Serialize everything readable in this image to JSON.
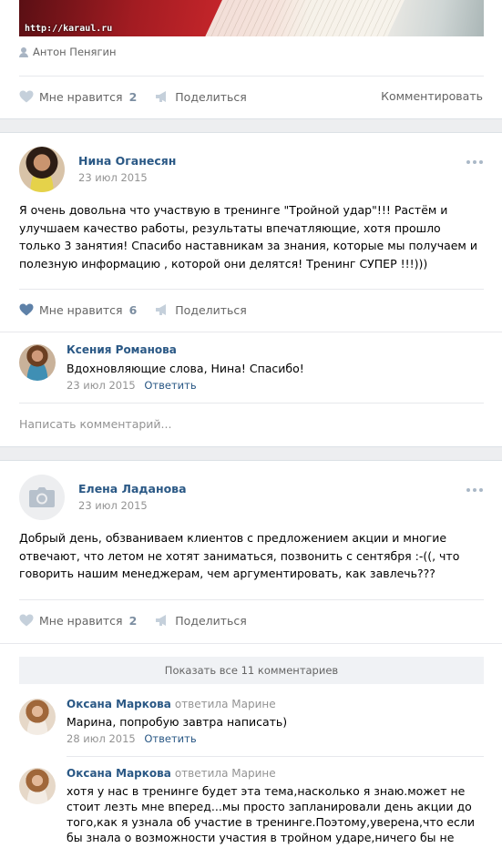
{
  "post1": {
    "watermark": "http://karaul.ru",
    "author": "Антон Пенягин",
    "actions": {
      "like_label": "Мне нравится",
      "like_count": "2",
      "share_label": "Поделиться",
      "comment_label": "Комментировать"
    }
  },
  "post2": {
    "author": "Нина Оганесян",
    "date": "23 июл 2015",
    "text": "Я очень довольна что участвую в тренинге \"Тройной удар\"!!! Растём и улучшаем качество работы, результаты впечатляющие, хотя прошло только 3 занятия! Спасибо наставникам за знания, которые мы получаем и полезную информацию , которой они делятся! Тренинг СУПЕР !!!)))",
    "actions": {
      "like_label": "Мне нравится",
      "like_count": "6",
      "share_label": "Поделиться"
    },
    "comment": {
      "author": "Ксения Романова",
      "text": "Вдохновляющие слова, Нина! Спасибо!",
      "date": "23 июл 2015",
      "reply": "Ответить"
    },
    "write_placeholder": "Написать комментарий..."
  },
  "post3": {
    "author": "Елена Ладанова",
    "date": "23 июл 2015",
    "text": "Добрый день, обзваниваем клиентов с предложением акции и многие отвечают, что летом не хотят заниматься, позвонить с сентября :-((, что говорить нашим менеджерам, чем аргументировать, как завлечь???",
    "actions": {
      "like_label": "Мне нравится",
      "like_count": "2",
      "share_label": "Поделиться"
    },
    "show_all": "Показать все 11 комментариев",
    "comments": [
      {
        "author": "Оксана Маркова",
        "replied": "ответила Марине",
        "text": "Марина, попробую завтра написать)",
        "date": "28 июл 2015",
        "reply": "Ответить"
      },
      {
        "author": "Оксана Маркова",
        "replied": "ответила Марине",
        "text": "хотя у нас в тренинге будет эта тема,насколько я знаю.может не стоит лезть мне вперед...мы просто запланировали день акции до того,как я узнала об участие в тренинге.Поэтому,уверена,что если бы знала о возможности участия в тройном ударе,ничего бы не стала делать)Сам"
      }
    ]
  },
  "colors": {
    "link": "#2a5885",
    "muted": "#939393",
    "background": "#edeef0"
  },
  "icons": [
    "user-icon",
    "heart-icon",
    "megaphone-icon",
    "more-dots-icon",
    "camera-icon"
  ]
}
